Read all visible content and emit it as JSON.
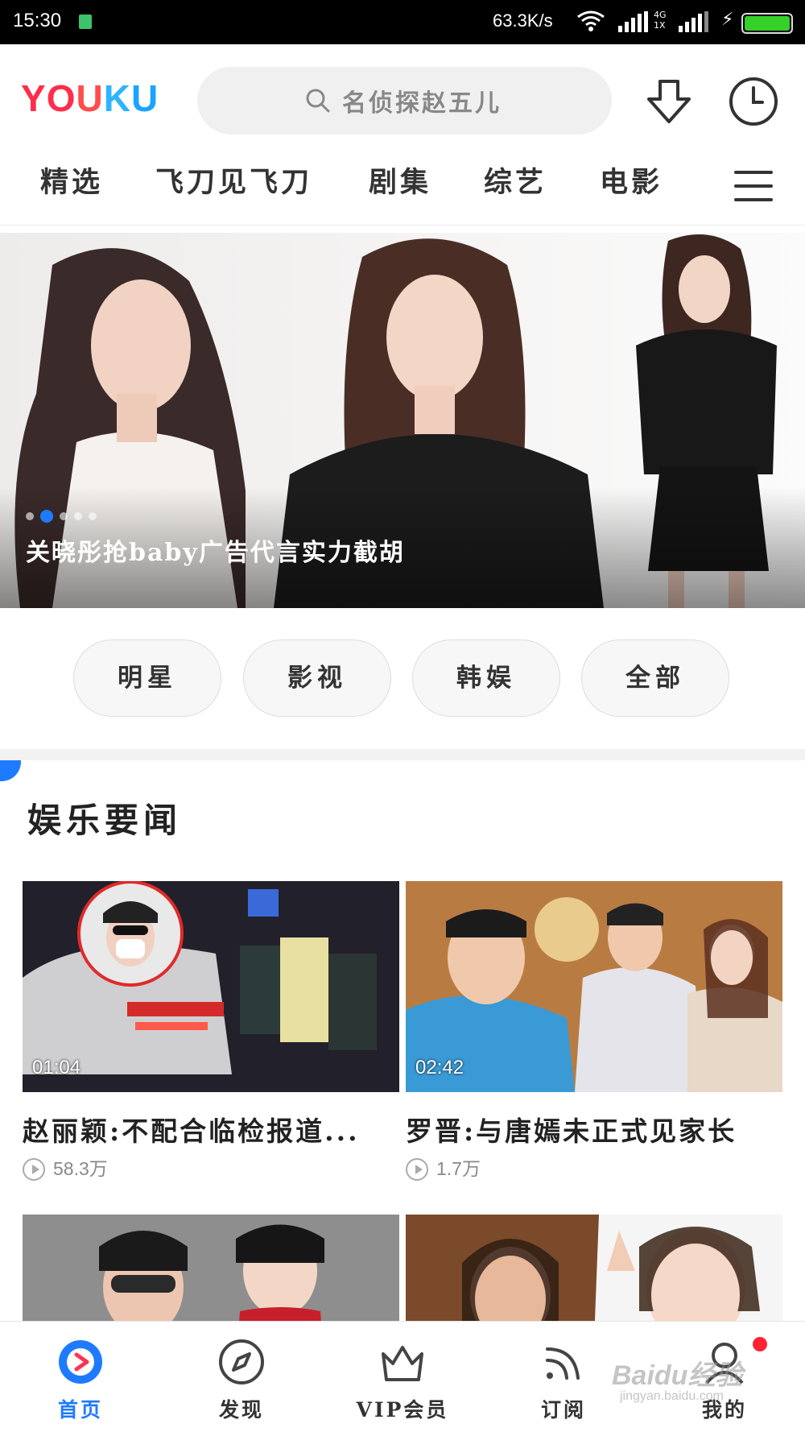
{
  "status_bar": {
    "time": "15:30",
    "network_speed": "63.3K/s",
    "network_type": "4G\n1X",
    "battery_color": "#35d02a"
  },
  "header": {
    "logo_letters": [
      "Y",
      "O",
      "U",
      "K",
      "U"
    ],
    "search_placeholder": "名侦探赵五儿",
    "search_icon": "search-icon",
    "download_icon": "download-icon",
    "history_icon": "clock-icon"
  },
  "tabs": [
    {
      "label": "精选"
    },
    {
      "label": "飞刀见飞刀"
    },
    {
      "label": "剧集"
    },
    {
      "label": "综艺"
    },
    {
      "label": "电影"
    }
  ],
  "banner": {
    "caption": "关晓彤抢baby广告代言实力截胡",
    "dots_count": 5,
    "active_dot": 1
  },
  "categories": [
    {
      "label": "明星"
    },
    {
      "label": "影视"
    },
    {
      "label": "韩娱"
    },
    {
      "label": "全部"
    }
  ],
  "section": {
    "title": "娱乐要闻"
  },
  "videos": [
    {
      "title": "赵丽颖:不配合临检报道...",
      "duration": "01:04",
      "views": "58.3万"
    },
    {
      "title": "罗晋:与唐嫣未正式见家长",
      "duration": "02:42",
      "views": "1.7万"
    },
    {
      "title": "",
      "duration": "",
      "views": ""
    },
    {
      "title": "",
      "duration": "",
      "views": ""
    }
  ],
  "bottom_nav": [
    {
      "label": "首页",
      "icon": "home-play-icon",
      "active": true
    },
    {
      "label": "发现",
      "icon": "compass-icon",
      "active": false
    },
    {
      "label": "VIP会员",
      "icon": "crown-icon",
      "active": false
    },
    {
      "label": "订阅",
      "icon": "rss-icon",
      "active": false
    },
    {
      "label": "我的",
      "icon": "user-icon",
      "active": false
    }
  ],
  "watermark": {
    "text": "Baidu经验",
    "sub": "jingyan.baidu.com"
  },
  "colors": {
    "accent": "#1e7bff",
    "logo_red": "#ff2d4a",
    "logo_blue": "#1aa3ff"
  }
}
